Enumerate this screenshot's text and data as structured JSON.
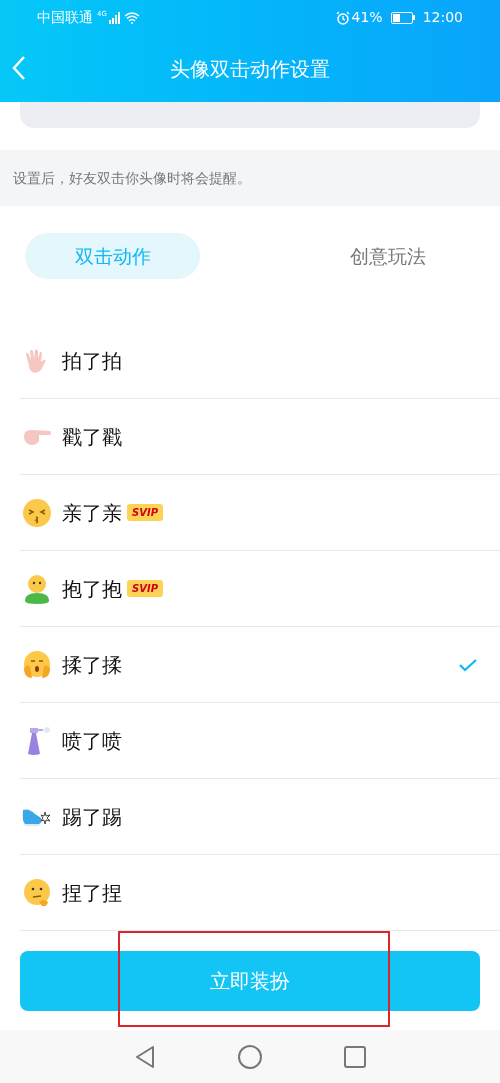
{
  "status_bar": {
    "carrier": "中国联通",
    "network": "4G",
    "battery": "41%",
    "time": "12:00"
  },
  "header": {
    "title": "头像双击动作设置"
  },
  "notice": "设置后，好友双击你头像时将会提醒。",
  "tabs": [
    {
      "label": "双击动作",
      "selected": true
    },
    {
      "label": "创意玩法",
      "selected": false
    }
  ],
  "actions": [
    {
      "label": "拍了拍",
      "selected": false
    },
    {
      "label": "戳了戳",
      "selected": false
    },
    {
      "label": "亲了亲",
      "badge": "SVIP",
      "selected": false
    },
    {
      "label": "抱了抱",
      "badge": "SVIP",
      "selected": false
    },
    {
      "label": "揉了揉",
      "selected": true
    },
    {
      "label": "喷了喷",
      "selected": false
    },
    {
      "label": "踢了踢",
      "selected": false
    },
    {
      "label": "捏了捏",
      "selected": false
    }
  ],
  "apply_button": {
    "label": "立即装扮",
    "highlighted": true
  }
}
